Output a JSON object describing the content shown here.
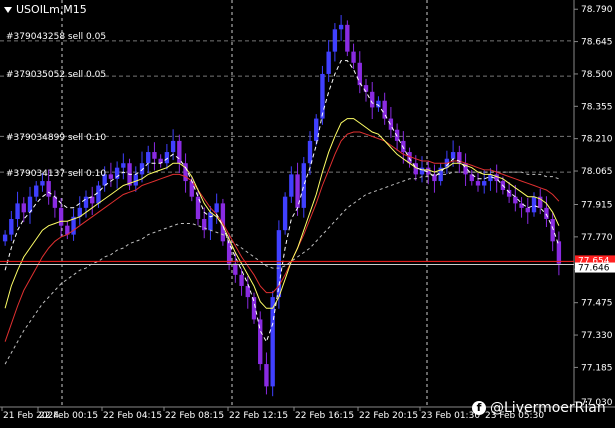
{
  "symbol": "USOILm,M15",
  "orders": [
    {
      "label": "#379043258 sell 0.05",
      "price": 78.648
    },
    {
      "label": "#379035052 sell 0.05",
      "price": 78.49
    },
    {
      "label": "#379034899 sell 0.10",
      "price": 78.22
    },
    {
      "label": "#379034137 sell 0.10",
      "price": 78.06
    }
  ],
  "watermark": "@LivermoerRian",
  "chart_data": {
    "type": "candlestick",
    "ylim": [
      77.03,
      78.8
    ],
    "y_ticks": [
      "78.790",
      "78.645",
      "78.500",
      "78.355",
      "78.210",
      "78.065",
      "77.915",
      "77.770",
      "77.625",
      "77.475",
      "77.330",
      "77.185",
      "77.030"
    ],
    "x_ticks": [
      "21 Feb 2024",
      "22 Feb 00:15",
      "22 Feb 04:15",
      "22 Feb 08:15",
      "22 Feb 12:15",
      "22 Feb 16:15",
      "22 Feb 20:15",
      "23 Feb 01:30",
      "23 Feb 05:30"
    ],
    "current_price": 77.646,
    "current_price_label": "77.646",
    "red_price_level": 77.66,
    "bid_price_label": "77.654",
    "colors": {
      "bull": "#4040ff",
      "bear": "#8a2be2",
      "ma_fast": "#ffffff",
      "ma_yellow": "#ffff66",
      "ma_red": "#e03030",
      "ma_slow": "#c0c0c0",
      "grid": "#cccccc",
      "red_line": "#ff2020"
    },
    "price_path": [
      77.78,
      77.85,
      77.92,
      77.88,
      77.95,
      78.0,
      78.02,
      77.95,
      77.9,
      77.82,
      77.78,
      77.86,
      77.9,
      77.95,
      77.92,
      78.0,
      78.05,
      78.03,
      78.08,
      78.1,
      78.0,
      78.05,
      78.1,
      78.15,
      78.12,
      78.1,
      78.15,
      78.2,
      78.1,
      78.02,
      77.95,
      77.85,
      77.8,
      77.88,
      77.92,
      77.75,
      77.65,
      77.6,
      77.55,
      77.5,
      77.4,
      77.2,
      77.1,
      77.5,
      77.8,
      77.95,
      78.05,
      77.9,
      78.1,
      78.2,
      78.3,
      78.5,
      78.6,
      78.7,
      78.72,
      78.6,
      78.55,
      78.45,
      78.42,
      78.35,
      78.38,
      78.3,
      78.25,
      78.2,
      78.15,
      78.1,
      78.05,
      78.08,
      78.05,
      78.02,
      78.08,
      78.12,
      78.15,
      78.1,
      78.05,
      78.02,
      78.0,
      78.02,
      78.05,
      78.02,
      77.98,
      77.95,
      77.92,
      77.9,
      77.88,
      77.95,
      77.9,
      77.85,
      77.75,
      77.65
    ],
    "ma_fast": [
      77.62,
      77.72,
      77.8,
      77.85,
      77.88,
      77.92,
      77.95,
      77.97,
      77.95,
      77.92,
      77.9,
      77.9,
      77.92,
      77.94,
      77.95,
      77.97,
      78.0,
      78.02,
      78.04,
      78.06,
      78.05,
      78.05,
      78.07,
      78.1,
      78.1,
      78.1,
      78.12,
      78.14,
      78.12,
      78.08,
      78.02,
      77.95,
      77.88,
      77.86,
      77.87,
      77.82,
      77.74,
      77.68,
      77.62,
      77.56,
      77.48,
      77.35,
      77.3,
      77.38,
      77.55,
      77.72,
      77.85,
      77.9,
      78.0,
      78.08,
      78.18,
      78.32,
      78.42,
      78.5,
      78.56,
      78.56,
      78.52,
      78.46,
      78.42,
      78.37,
      78.36,
      78.32,
      78.27,
      78.22,
      78.17,
      78.12,
      78.08,
      78.07,
      78.06,
      78.04,
      78.06,
      78.09,
      78.12,
      78.11,
      78.08,
      78.05,
      78.03,
      78.03,
      78.04,
      78.03,
      78.0,
      77.97,
      77.95,
      77.92,
      77.9,
      77.91,
      77.9,
      77.87,
      77.81,
      77.73
    ],
    "ma_yellow": [
      77.45,
      77.55,
      77.62,
      77.68,
      77.72,
      77.76,
      77.8,
      77.82,
      77.83,
      77.84,
      77.84,
      77.85,
      77.86,
      77.88,
      77.9,
      77.92,
      77.94,
      77.96,
      77.98,
      78.0,
      78.01,
      78.02,
      78.03,
      78.05,
      78.06,
      78.07,
      78.08,
      78.1,
      78.1,
      78.08,
      78.04,
      77.98,
      77.92,
      77.88,
      77.86,
      77.82,
      77.76,
      77.7,
      77.65,
      77.6,
      77.55,
      77.48,
      77.45,
      77.45,
      77.5,
      77.58,
      77.66,
      77.72,
      77.8,
      77.88,
      77.96,
      78.06,
      78.15,
      78.22,
      78.28,
      78.3,
      78.3,
      78.28,
      78.26,
      78.24,
      78.23,
      78.2,
      78.17,
      78.14,
      78.12,
      78.1,
      78.08,
      78.07,
      78.07,
      78.06,
      78.07,
      78.08,
      78.1,
      78.1,
      78.09,
      78.08,
      78.06,
      78.05,
      78.05,
      78.04,
      78.03,
      78.01,
      77.99,
      77.97,
      77.95,
      77.95,
      77.94,
      77.92,
      77.88,
      77.82
    ],
    "ma_red": [
      77.3,
      77.38,
      77.46,
      77.53,
      77.58,
      77.63,
      77.68,
      77.72,
      77.75,
      77.77,
      77.78,
      77.8,
      77.82,
      77.84,
      77.86,
      77.88,
      77.9,
      77.92,
      77.94,
      77.96,
      77.97,
      77.98,
      78.0,
      78.01,
      78.02,
      78.03,
      78.04,
      78.05,
      78.05,
      78.04,
      78.02,
      77.98,
      77.94,
      77.9,
      77.87,
      77.83,
      77.78,
      77.73,
      77.68,
      77.64,
      77.6,
      77.55,
      77.52,
      77.52,
      77.55,
      77.6,
      77.66,
      77.72,
      77.78,
      77.85,
      77.92,
      78.0,
      78.07,
      78.14,
      78.2,
      78.23,
      78.24,
      78.24,
      78.23,
      78.22,
      78.21,
      78.2,
      78.18,
      78.16,
      78.14,
      78.13,
      78.12,
      78.11,
      78.11,
      78.1,
      78.1,
      78.1,
      78.11,
      78.11,
      78.1,
      78.09,
      78.08,
      78.07,
      78.07,
      78.06,
      78.05,
      78.04,
      78.03,
      78.02,
      78.01,
      78.0,
      77.99,
      77.98,
      77.96,
      77.93
    ],
    "ma_slow": [
      77.2,
      77.25,
      77.3,
      77.35,
      77.39,
      77.43,
      77.47,
      77.5,
      77.53,
      77.56,
      77.58,
      77.6,
      77.62,
      77.63,
      77.65,
      77.66,
      77.68,
      77.69,
      77.71,
      77.72,
      77.74,
      77.75,
      77.76,
      77.78,
      77.79,
      77.8,
      77.81,
      77.82,
      77.83,
      77.83,
      77.83,
      77.82,
      77.81,
      77.8,
      77.79,
      77.78,
      77.76,
      77.74,
      77.72,
      77.7,
      77.68,
      77.66,
      77.64,
      77.63,
      77.63,
      77.64,
      77.66,
      77.68,
      77.7,
      77.72,
      77.75,
      77.78,
      77.81,
      77.84,
      77.87,
      77.9,
      77.92,
      77.94,
      77.96,
      77.97,
      77.98,
      77.99,
      78.0,
      78.01,
      78.02,
      78.03,
      78.03,
      78.04,
      78.04,
      78.05,
      78.05,
      78.05,
      78.06,
      78.06,
      78.06,
      78.06,
      78.06,
      78.06,
      78.06,
      78.06,
      78.06,
      78.06,
      78.06,
      78.06,
      78.05,
      78.05,
      78.05,
      78.04,
      78.04,
      78.03
    ]
  }
}
